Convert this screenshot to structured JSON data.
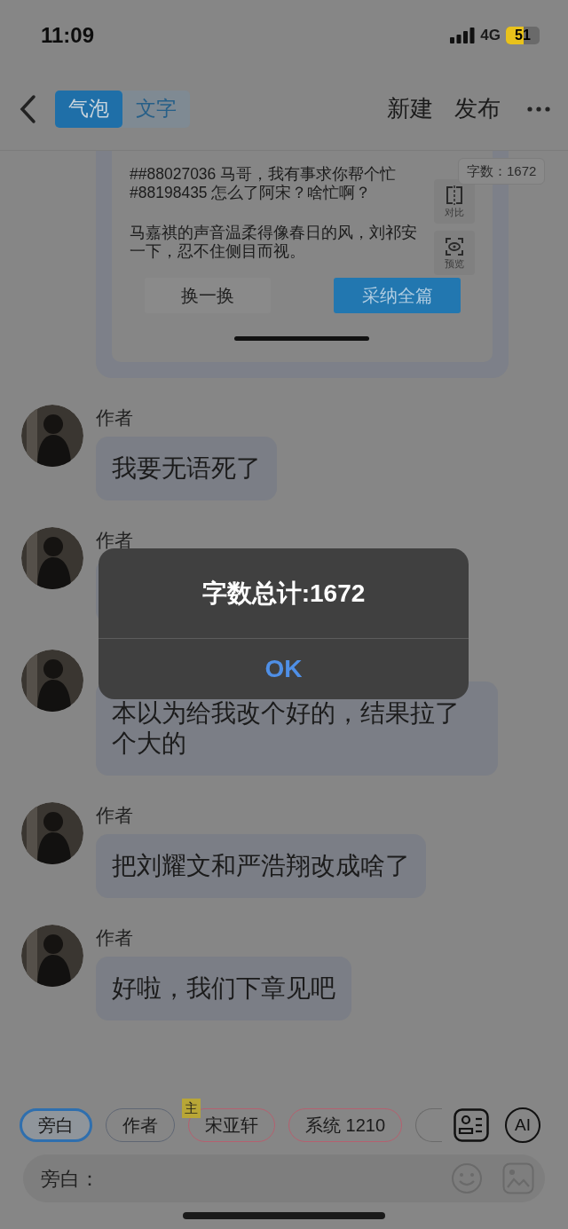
{
  "status_bar": {
    "time": "11:09",
    "network": "4G",
    "battery": "51"
  },
  "nav": {
    "tabs": [
      {
        "label": "气泡",
        "selected": true
      },
      {
        "label": "文字",
        "selected": false
      }
    ],
    "actions": [
      "新建",
      "发布"
    ]
  },
  "preview": {
    "word_count": "字数：1672",
    "paragraphs": [
      [
        "##88027036 马哥，我有事求你帮个忙",
        "#88198435 怎么了阿宋？啥忙啊？"
      ],
      [
        "马嘉祺的声音温柔得像春日的风，刘祁安",
        "一下，忍不住侧目而视。"
      ]
    ],
    "side_buttons": [
      "对比",
      "预览"
    ],
    "buttons": [
      {
        "label": "换一换",
        "kind": "secondary"
      },
      {
        "label": "采纳全篇",
        "kind": "primary"
      }
    ]
  },
  "messages": [
    {
      "name": "作者",
      "text": "我要无语死了"
    },
    {
      "name": "作者"
    },
    {
      "text": "本以为给我改个好的，结果拉了个大的"
    },
    {
      "name": "作者",
      "text": "把刘耀文和严浩翔改成啥了"
    },
    {
      "name": "作者",
      "text": "好啦，我们下章见吧"
    }
  ],
  "alert": {
    "title": "字数总计:1672",
    "button": "OK"
  },
  "speakers": [
    {
      "label": "旁白",
      "selected": true,
      "color": "#2f6fae"
    },
    {
      "label": "作者",
      "selected": false,
      "color": "#5f6673"
    },
    {
      "label": "宋亚轩",
      "selected": false,
      "color": "#b5606f",
      "badge": "主"
    },
    {
      "label": "系统 1210",
      "selected": false,
      "color": "#b5606f"
    }
  ],
  "ai_button": "AI",
  "input": {
    "placeholder": "旁白："
  }
}
